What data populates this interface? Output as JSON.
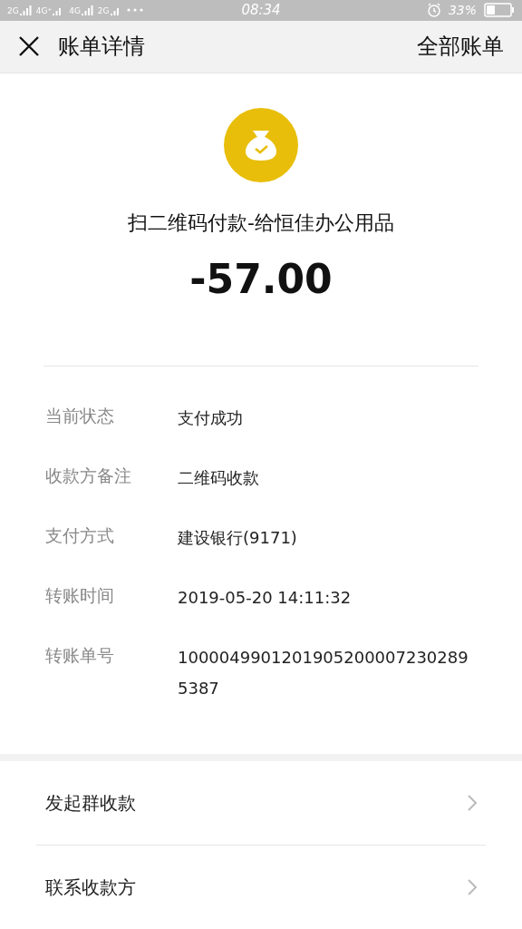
{
  "status_bar": {
    "network_labels": [
      "2G",
      "4G⁺",
      "4G",
      "2G"
    ],
    "time": "08:34",
    "battery": "33%"
  },
  "header": {
    "title": "账单详情",
    "action": "全部账单"
  },
  "summary": {
    "title": "扫二维码付款-给恒佳办公用品",
    "amount": "-57.00"
  },
  "details": [
    {
      "label": "当前状态",
      "value": "支付成功"
    },
    {
      "label": "收款方备注",
      "value": "二维码收款"
    },
    {
      "label": "支付方式",
      "value": "建设银行(9171)"
    },
    {
      "label": "转账时间",
      "value": "2019-05-20 14:11:32"
    },
    {
      "label": "转账单号",
      "value": "10000499012019052000072302895387"
    }
  ],
  "actions": [
    {
      "label": "发起群收款"
    },
    {
      "label": "联系收款方"
    }
  ]
}
